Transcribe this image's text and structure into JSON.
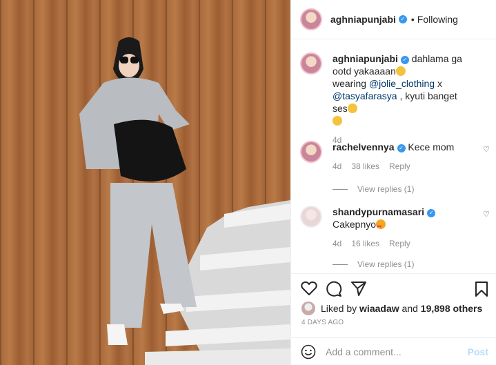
{
  "post": {
    "username": "aghniapunjabi",
    "follow_separator": "•",
    "follow_status": "Following"
  },
  "caption": {
    "username": "aghniapunjabi",
    "text_1": "dahlama ga ootd yakaaaan",
    "text_2": "wearing ",
    "mention_1": "@jolie_clothing",
    "text_3": " x ",
    "mention_2": "@tasyafarasya",
    "text_4": " , kyuti banget ses",
    "time": "4d"
  },
  "comments": [
    {
      "username": "rachelvennya",
      "text": "Kece mom",
      "time": "4d",
      "likes": "38 likes",
      "reply": "Reply",
      "view_replies": "View replies (1)"
    },
    {
      "username": "shandypurnamasari",
      "text": "Cakepnyo",
      "time": "4d",
      "likes": "16 likes",
      "reply": "Reply",
      "view_replies": "View replies (1)"
    }
  ],
  "likes": {
    "prefix": "Liked by ",
    "user": "wiaadaw",
    "and": " and ",
    "count": "19,898 others"
  },
  "date": "4 DAYS AGO",
  "add_comment": {
    "placeholder": "Add a comment...",
    "post_label": "Post"
  },
  "colors": {
    "link": "#00376b",
    "verified": "#3897f0",
    "muted": "#8e8e8e",
    "post_disabled": "#b2dffc"
  }
}
